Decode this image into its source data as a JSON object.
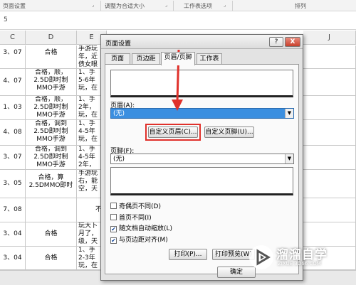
{
  "ribbon": {
    "groups": [
      "页面设置",
      "调整为合适大小",
      "工作表选项",
      "排列"
    ]
  },
  "formula": {
    "row_number": "5"
  },
  "columns": [
    "C",
    "D",
    "E",
    "J"
  ],
  "rows": [
    {
      "c": "3、07",
      "d": "合格",
      "e": "手游玩\n年，近\n债女眼"
    },
    {
      "c": "4、07",
      "d": "合格，顺，\n2.5D即时制\nMMO手游",
      "e": "1、手\n5-6年\n玩，在"
    },
    {
      "c": "1、03",
      "d": "合格，顺，\n2.5D即时制\nMMO手游",
      "e": "1、手\n2年，\n玩，在"
    },
    {
      "c": "4、08",
      "d": "合格，调到\n2.5D即时制\nMMO手游",
      "e": "1、手\n4-5年\n玩，在"
    },
    {
      "c": "3、07",
      "d": "合格，调到\n2.5D即时制\nMMO手游",
      "e": "1、手\n4-5年\n2年，"
    },
    {
      "c": "3、05",
      "d": "合格，算\n2.5DMMO即时",
      "e": "手游玩\n右，能\n空，天"
    },
    {
      "c": "7、08",
      "d": "",
      "e": "不"
    },
    {
      "c": "3、04",
      "d": "合格",
      "e": "玩大卜\n月了，\n级，天"
    },
    {
      "c": "3、04",
      "d": "合格",
      "e": "1、手\n2-3年\n玩，在"
    }
  ],
  "dialog": {
    "title": "页面设置",
    "help": "?",
    "close": "X",
    "tabs": [
      "页面",
      "页边距",
      "页眉/页脚",
      "工作表"
    ],
    "active_tab": "页眉/页脚",
    "header_label": "页眉(A):",
    "header_value": "(无)",
    "custom_header_button": "自定义页眉(C)...",
    "custom_footer_button": "自定义页脚(U)...",
    "footer_label": "页脚(F):",
    "footer_value": "(无)",
    "checkboxes": [
      {
        "label": "奇偶页不同(D)",
        "checked": false
      },
      {
        "label": "首页不同(I)",
        "checked": false
      },
      {
        "label": "随文档自动缩放(L)",
        "checked": true
      },
      {
        "label": "与页边距对齐(M)",
        "checked": true
      }
    ],
    "print_button": "打印(P)...",
    "print_preview_button": "打印预览(W)",
    "ok_button": "确定",
    "accent": "#3b8fe0",
    "highlight_color": "#e0312b"
  },
  "watermark": {
    "name": "溜溜自学",
    "url": "ZIXUE.3D66.COM"
  }
}
